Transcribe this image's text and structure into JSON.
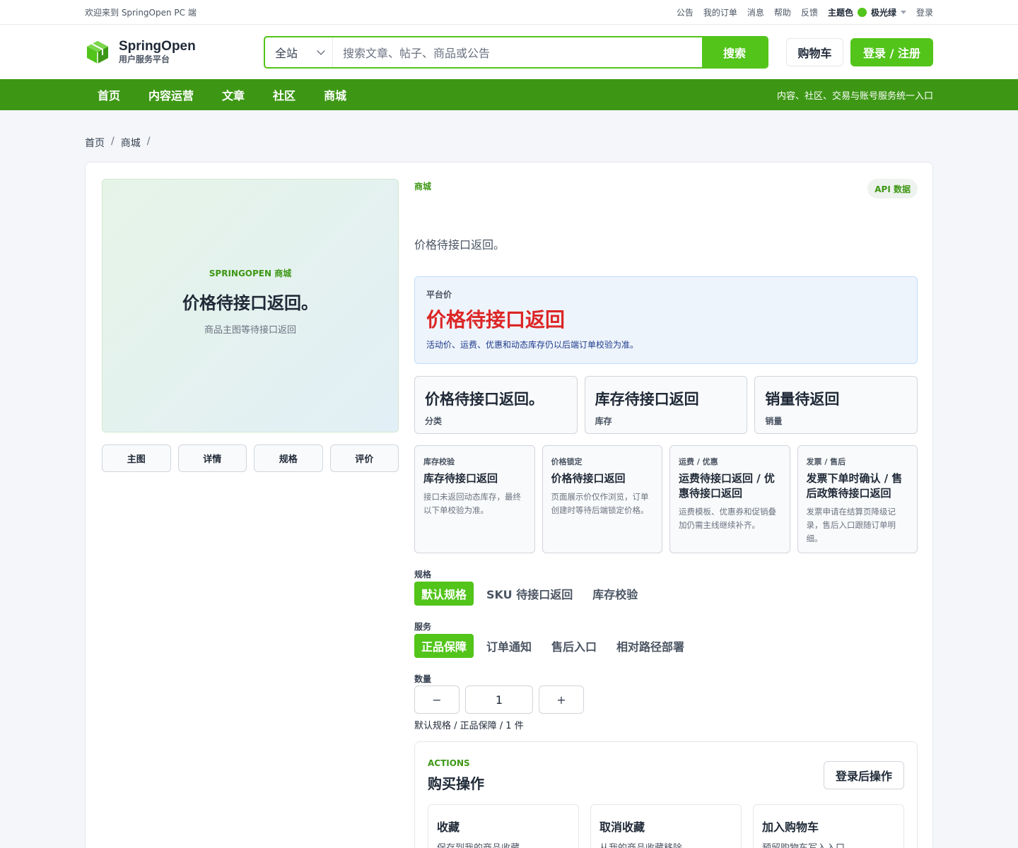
{
  "topbar": {
    "welcome": "欢迎来到 SpringOpen PC 端",
    "links": [
      "公告",
      "我的订单",
      "消息",
      "帮助",
      "反馈"
    ],
    "theme_label": "主题色",
    "theme_value": "极光绿",
    "theme_color": "#52c41a",
    "login": "登录"
  },
  "header": {
    "brand": "SpringOpen",
    "brand_sub": "用户服务平台",
    "search_scope": "全站",
    "search_placeholder": "搜索文章、帖子、商品或公告",
    "search_button": "搜索",
    "cart": "购物车",
    "login_register": "登录 / 注册"
  },
  "nav": {
    "items": [
      "首页",
      "内容运营",
      "文章",
      "社区",
      "商城"
    ],
    "slogan": "内容、社区、交易与账号服务统一入口"
  },
  "breadcrumb": [
    "首页",
    "商城"
  ],
  "gallery": {
    "kicker": "SPRINGOPEN 商城",
    "title": "价格待接口返回。",
    "note": "商品主图等待接口返回",
    "thumbs": [
      "主图",
      "详情",
      "规格",
      "评价"
    ]
  },
  "product": {
    "category": "商城",
    "badge": "API 数据",
    "desc": "价格待接口返回。",
    "price_label": "平台价",
    "price_value": "价格待接口返回",
    "price_note": "活动价、运费、优惠和动态库存仍以后端订单校验为准。",
    "stats": [
      {
        "value": "价格待接口返回。",
        "label": "分类"
      },
      {
        "value": "库存待接口返回",
        "label": "库存"
      },
      {
        "value": "销量待返回",
        "label": "销量"
      }
    ],
    "infos": [
      {
        "kicker": "库存校验",
        "title": "库存待接口返回",
        "desc": "接口未返回动态库存，最终以下单校验为准。"
      },
      {
        "kicker": "价格锁定",
        "title": "价格待接口返回",
        "desc": "页面展示价仅作浏览，订单创建时等待后端锁定价格。"
      },
      {
        "kicker": "运费 / 优惠",
        "title": "运费待接口返回 / 优惠待接口返回",
        "desc": "运费模板、优惠券和促销叠加仍需主线继续补齐。"
      },
      {
        "kicker": "发票 / 售后",
        "title": "发票下单时确认 / 售后政策待接口返回",
        "desc": "发票申请在结算页降级记录，售后入口跟随订单明细。"
      }
    ],
    "spec_label": "规格",
    "specs": [
      "默认规格",
      "SKU 待接口返回",
      "库存校验"
    ],
    "service_label": "服务",
    "services": [
      "正品保障",
      "订单通知",
      "售后入口",
      "相对路径部署"
    ],
    "qty_label": "数量",
    "qty_minus": "−",
    "qty_value": "1",
    "qty_plus": "+",
    "selection": "默认规格 / 正品保障 / 1 件"
  },
  "actions": {
    "kicker": "ACTIONS",
    "title": "购买操作",
    "login_op": "登录后操作",
    "cards": [
      {
        "title": "收藏",
        "desc": "保存到我的商品收藏。"
      },
      {
        "title": "取消收藏",
        "desc": "从我的商品收藏移除。"
      },
      {
        "title": "加入购物车",
        "desc": "预留购物车写入入口。"
      }
    ]
  }
}
